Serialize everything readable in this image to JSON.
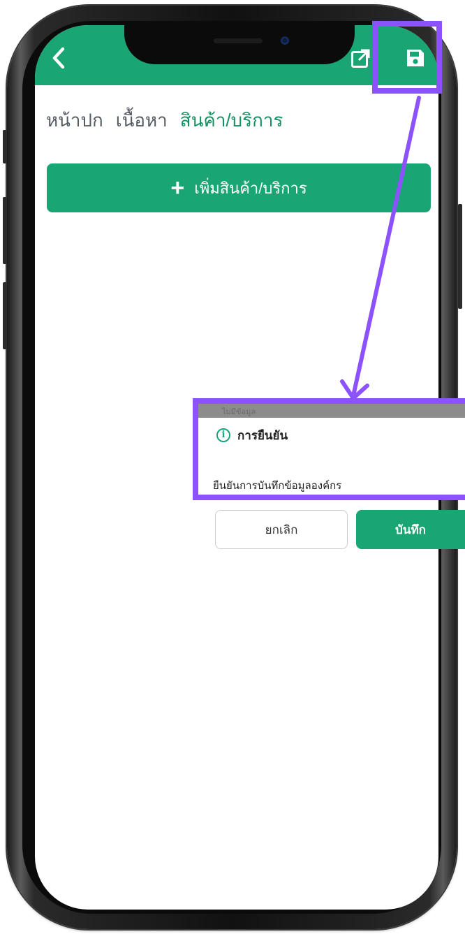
{
  "header": {
    "back_icon": "chevron-left-icon",
    "edit_icon": "external-link-icon",
    "save_icon": "floppy-disk-icon",
    "bg_color": "#1aa574"
  },
  "tabs": [
    {
      "label": "หน้าปก",
      "active": false
    },
    {
      "label": "เนื้อหา",
      "active": false
    },
    {
      "label": "สินค้า/บริการ",
      "active": true
    }
  ],
  "add_button": {
    "label": "เพิ่มสินค้า/บริการ",
    "icon": "plus-icon"
  },
  "dialog": {
    "background_text": "ไม่มีข้อมูล",
    "title": "การยืนยัน",
    "message": "ยืนยันการบันทึกข้อมูลองค์กร",
    "cancel_label": "ยกเลิก",
    "confirm_label": "บันทึก",
    "icon": "info-icon"
  },
  "annotation": {
    "highlight_color": "#8c52ff"
  }
}
